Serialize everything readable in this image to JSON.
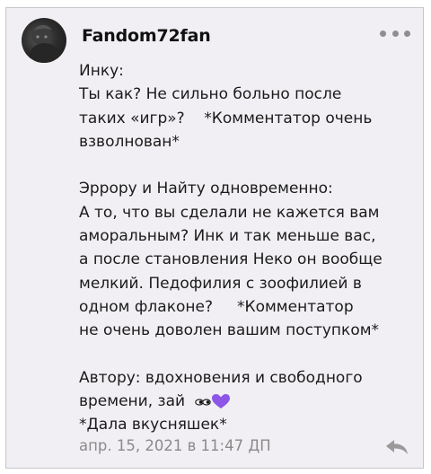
{
  "comment": {
    "username": "Fandom72fan",
    "avatar_icon": "avatar-icon",
    "more_icon": "more-options-icon",
    "lines": [
      "Инку:",
      "Ты как? Не сильно больно после",
      "таких «игр»?    *Комментатор очень",
      "взволнован*",
      "",
      "Эррору и Найту одновременно:",
      "А то, что вы сделали не кажется вам",
      "аморальным? Инк и так меньше вас,",
      "а после становления Неко он вообще",
      "мелкий. Педофилия с зоофилией в",
      "одном флаконе?     *Комментатор",
      "не очень доволен вашим поступком*",
      "",
      "Автору: вдохновения и свободного",
      "времени, зай",
      "*Дала вкусняшек*"
    ],
    "emoji": "eyes-and-purple-heart-emoji",
    "heart_color": "#8e56e6",
    "timestamp": "апр. 15, 2021 в 11:47 ДП",
    "reply_icon": "reply-arrow-icon"
  }
}
